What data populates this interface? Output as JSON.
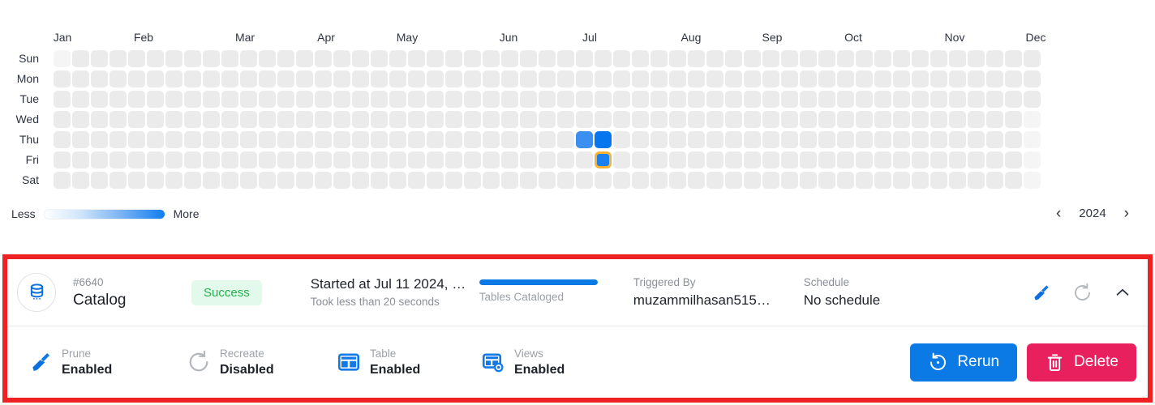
{
  "heatmap": {
    "months": [
      "Jan",
      "Feb",
      "Mar",
      "Apr",
      "May",
      "Jun",
      "Jul",
      "Aug",
      "Sep",
      "Oct",
      "Nov",
      "Dec"
    ],
    "days": [
      "Sun",
      "Mon",
      "Tue",
      "Wed",
      "Thu",
      "Fri",
      "Sat"
    ],
    "legend": {
      "less_label": "Less",
      "more_label": "More"
    },
    "year_nav": {
      "prev": "‹",
      "year": "2024",
      "next": "›"
    },
    "colors": {
      "empty_cell": "#ebebeb",
      "out_of_range_cell": "#f5f5f5",
      "level_low": "#3b8ff0",
      "level_high": "#0576ee",
      "selected_border": "#f9b233"
    },
    "weeks": 53,
    "active_cells": [
      {
        "week": 28,
        "day": 4,
        "color": "#3b8ff0",
        "selected": false
      },
      {
        "week": 29,
        "day": 4,
        "color": "#0576ee",
        "selected": false
      },
      {
        "week": 29,
        "day": 5,
        "color": "#1a7ff0",
        "selected": true
      }
    ],
    "out_of_range": [
      {
        "week": 0,
        "day": 0
      },
      {
        "week": 52,
        "day": 3
      },
      {
        "week": 52,
        "day": 4
      },
      {
        "week": 52,
        "day": 5
      },
      {
        "week": 52,
        "day": 6
      }
    ]
  },
  "run_card": {
    "highlight_color": "#ee2222",
    "run_id": "#6640",
    "run_name": "Catalog",
    "status": "Success",
    "started": {
      "title": "Started at Jul 11 2024, …",
      "subtitle": "Took less than 20 seconds"
    },
    "progress": {
      "label": "Tables Cataloged",
      "percent": 100
    },
    "triggered_by": {
      "label": "Triggered By",
      "value": "muzammilhasan515…"
    },
    "schedule": {
      "label": "Schedule",
      "value": "No schedule"
    },
    "details": [
      {
        "icon": "broom-icon",
        "label": "Prune",
        "value": "Enabled"
      },
      {
        "icon": "recreate-icon",
        "label": "Recreate",
        "value": "Disabled"
      },
      {
        "icon": "table-icon",
        "label": "Table",
        "value": "Enabled"
      },
      {
        "icon": "views-icon",
        "label": "Views",
        "value": "Enabled"
      }
    ],
    "actions": {
      "rerun_label": "Rerun",
      "delete_label": "Delete"
    }
  }
}
